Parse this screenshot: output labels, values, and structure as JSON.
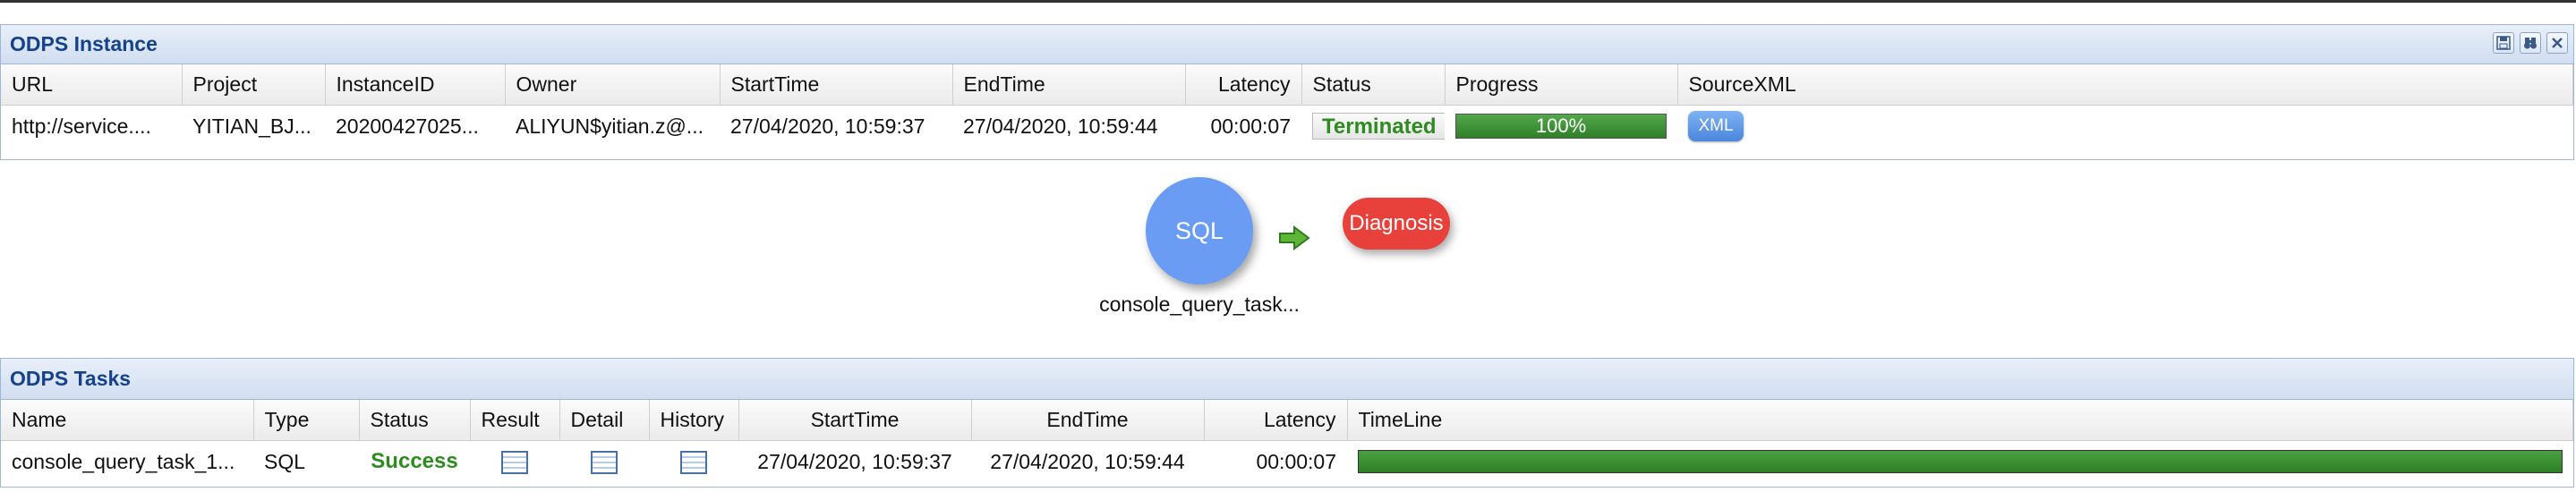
{
  "instance_panel": {
    "title": "ODPS Instance",
    "tools": [
      "save-icon",
      "binoculars-icon",
      "close-icon"
    ],
    "columns": [
      "URL",
      "Project",
      "InstanceID",
      "Owner",
      "StartTime",
      "EndTime",
      "Latency",
      "Status",
      "Progress",
      "SourceXML"
    ],
    "row": {
      "url": "http://service....",
      "project": "YITIAN_BJ...",
      "instance_id": "20200427025...",
      "owner": "ALIYUN$yitian.z@...",
      "start_time": "27/04/2020, 10:59:37",
      "end_time": "27/04/2020, 10:59:44",
      "latency": "00:00:07",
      "status": "Terminated",
      "progress_text": "100%",
      "progress_fraction": 1.0,
      "source_xml": "XML"
    }
  },
  "graph": {
    "task_node_label": "SQL",
    "task_node_caption": "console_query_task...",
    "arrow_icon": "arrow-right-icon",
    "diagnosis_label": "Diagnosis"
  },
  "tasks_panel": {
    "title": "ODPS Tasks",
    "columns": [
      "Name",
      "Type",
      "Status",
      "Result",
      "Detail",
      "History",
      "StartTime",
      "EndTime",
      "Latency",
      "TimeLine"
    ],
    "row": {
      "name": "console_query_task_1...",
      "type": "SQL",
      "status": "Success",
      "result_icon": "table-icon",
      "detail_icon": "table-icon",
      "history_icon": "table-icon",
      "start_time": "27/04/2020, 10:59:37",
      "end_time": "27/04/2020, 10:59:44",
      "latency": "00:00:07",
      "timeline_fraction": 1.0
    }
  },
  "colors": {
    "panel_title": "#15428b",
    "success_green": "#2e8b1f",
    "progress_green": "#2f7f28",
    "sql_node": "#6b9cf4",
    "diagnosis_node": "#e8403b",
    "xml_button": "#4a86dd"
  }
}
